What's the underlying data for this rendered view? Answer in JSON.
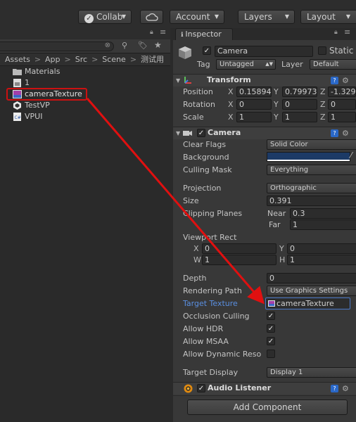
{
  "toolbar": {
    "collab_label": "Collab",
    "cloud_icon": "cloud-icon",
    "account_label": "Account",
    "layers_label": "Layers",
    "layout_label": "Layout"
  },
  "project": {
    "breadcrumb": [
      "Assets",
      "App",
      "Src",
      "Scene",
      "测试用"
    ],
    "items": [
      {
        "name": "Materials",
        "icon": "folder-icon"
      },
      {
        "name": "1",
        "icon": "scene-file-icon"
      },
      {
        "name": "cameraTexture",
        "icon": "render-texture-icon"
      },
      {
        "name": "TestVP",
        "icon": "unity-scene-icon"
      },
      {
        "name": "VPUI",
        "icon": "script-file-icon"
      }
    ]
  },
  "inspector": {
    "tab_label": "Inspector",
    "object_name": "Camera",
    "static_label": "Static",
    "tag_label": "Tag",
    "tag_value": "Untagged",
    "layer_label": "Layer",
    "layer_value": "Default",
    "transform": {
      "title": "Transform",
      "position_label": "Position",
      "rotation_label": "Rotation",
      "scale_label": "Scale",
      "position": {
        "x": "0.15894",
        "y": "0.79973",
        "z": "-1.329"
      },
      "rotation": {
        "x": "0",
        "y": "0",
        "z": "0"
      },
      "scale": {
        "x": "1",
        "y": "1",
        "z": "1"
      },
      "axis_x": "X",
      "axis_y": "Y",
      "axis_z": "Z"
    },
    "camera": {
      "title": "Camera",
      "clear_flags_label": "Clear Flags",
      "clear_flags_value": "Solid Color",
      "background_label": "Background",
      "background_color": "#1c3a66",
      "culling_mask_label": "Culling Mask",
      "culling_mask_value": "Everything",
      "projection_label": "Projection",
      "projection_value": "Orthographic",
      "size_label": "Size",
      "size_value": "0.391",
      "clipping_label": "Clipping Planes",
      "near_label": "Near",
      "near_value": "0.3",
      "far_label": "Far",
      "far_value": "1",
      "viewport_label": "Viewport Rect",
      "vp_x_label": "X",
      "vp_x": "0",
      "vp_y_label": "Y",
      "vp_y": "0",
      "vp_w_label": "W",
      "vp_w": "1",
      "vp_h_label": "H",
      "vp_h": "1",
      "depth_label": "Depth",
      "depth_value": "0",
      "rendering_path_label": "Rendering Path",
      "rendering_path_value": "Use Graphics Settings",
      "target_texture_label": "Target Texture",
      "target_texture_value": "cameraTexture",
      "occlusion_label": "Occlusion Culling",
      "hdr_label": "Allow HDR",
      "msaa_label": "Allow MSAA",
      "dynres_label": "Allow Dynamic Reso",
      "target_display_label": "Target Display",
      "target_display_value": "Display 1"
    },
    "audio_listener": {
      "title": "Audio Listener"
    },
    "add_component_label": "Add Component"
  },
  "colors": {
    "selection_highlight": "#cc1111",
    "arrow": "#e01010",
    "target_label_blue": "#5a8fe0"
  }
}
